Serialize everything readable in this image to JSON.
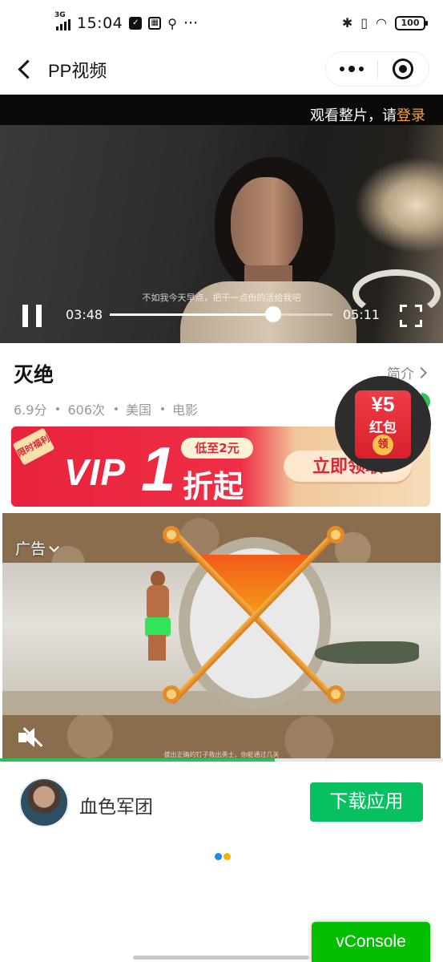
{
  "status_bar": {
    "network": "3G",
    "time": "15:04",
    "battery": "100"
  },
  "nav": {
    "title": "PP视频"
  },
  "player": {
    "login_hint_prefix": "观看整片，请",
    "login_link": "登录",
    "subtitle": "不如我今天早点，把干一点份的活给我吧",
    "current_time": "03:48",
    "duration": "05:11",
    "progress": 0.733
  },
  "movie": {
    "title": "灭绝",
    "intro_label": "简介",
    "meta": [
      "6.9分",
      "606次",
      "美国",
      "电影"
    ]
  },
  "vip_banner": {
    "tag": "限时福利",
    "main": "VIP",
    "number": "1",
    "low_badge": "低至2元",
    "suffix": "折起",
    "cta": "立即领取"
  },
  "red_packet": {
    "amount": "¥5",
    "label": "红包",
    "get": "领"
  },
  "ad": {
    "label": "广告",
    "caption": "拔出正确的钉子救出勇士，你能通过几关",
    "progress": 0.62,
    "advertiser": "血色军团",
    "download": "下载应用"
  },
  "vconsole": {
    "label": "vConsole"
  },
  "colors": {
    "wechat_green": "#07c160",
    "login_orange": "#f0a53a",
    "vip_red": "#e8223b"
  }
}
